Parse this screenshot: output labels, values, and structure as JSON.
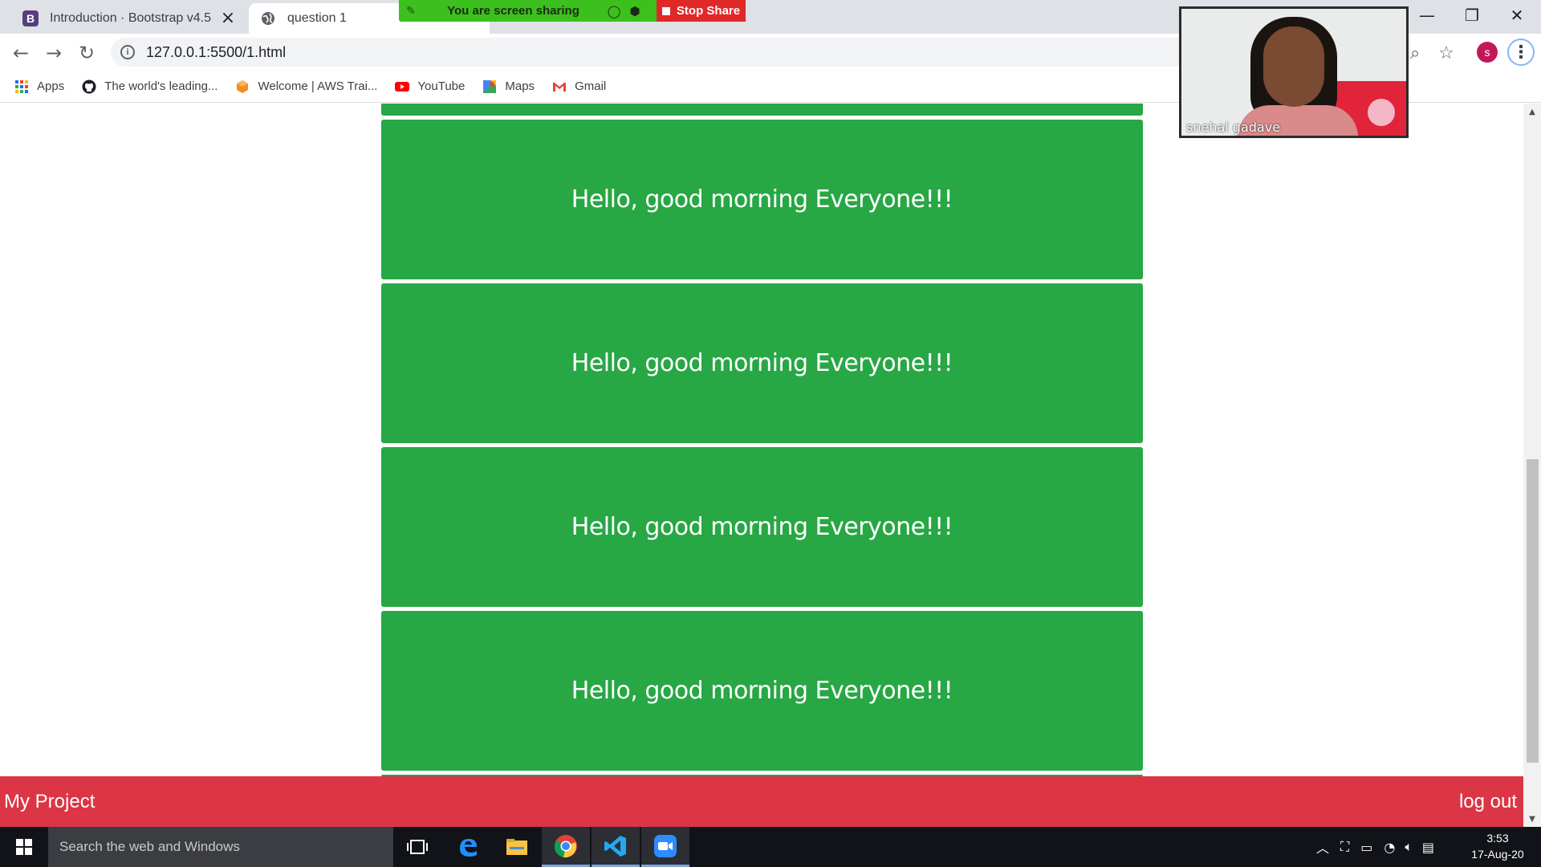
{
  "browser": {
    "tabs": [
      {
        "title": "Introduction · Bootstrap v4.5",
        "favicon": "bootstrap-icon",
        "active": false
      },
      {
        "title": "question 1",
        "favicon": "globe-icon",
        "active": true
      }
    ],
    "url": "127.0.0.1:5500/1.html",
    "profile_initial": "s",
    "bookmarks": [
      {
        "label": "Apps",
        "icon": "apps-grid-icon"
      },
      {
        "label": "The world's leading...",
        "icon": "github-icon"
      },
      {
        "label": "Welcome | AWS Trai...",
        "icon": "aws-icon"
      },
      {
        "label": "YouTube",
        "icon": "youtube-icon"
      },
      {
        "label": "Maps",
        "icon": "maps-icon"
      },
      {
        "label": "Gmail",
        "icon": "gmail-icon"
      }
    ]
  },
  "screen_share": {
    "status_text": "You are screen sharing",
    "stop_label": "Stop Share"
  },
  "video": {
    "participant_name": "snehal gadave"
  },
  "page": {
    "cards": [
      {
        "text": "Hello, good morning Everyone!!!"
      },
      {
        "text": "Hello, good morning Everyone!!!"
      },
      {
        "text": "Hello, good morning Everyone!!!"
      },
      {
        "text": "Hello, good morning Everyone!!!"
      }
    ],
    "footer": {
      "brand": "My Project",
      "logout": "log out"
    }
  },
  "taskbar": {
    "search_placeholder": "Search the web and Windows",
    "apps": [
      "task-view",
      "edge",
      "file-explorer",
      "chrome",
      "vscode",
      "zoom"
    ],
    "clock_time": "3:53",
    "clock_date": "17-Aug-20"
  },
  "colors": {
    "card_green": "#28a745",
    "footer_red": "#dc3545",
    "share_green": "#3cc01d",
    "stop_red": "#e02828"
  }
}
